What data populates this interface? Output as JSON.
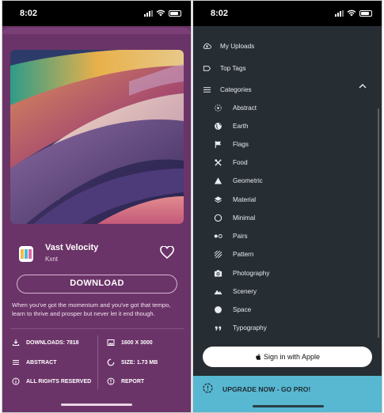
{
  "status_bar": {
    "time": "8:02"
  },
  "wallpaper": {
    "title": "Vast Velocity",
    "author": "Kxnt",
    "download_label": "DOWNLOAD",
    "description": "When you've got the momentum and you've got that tempo, learn to thrive and prosper but never let it end though.",
    "stats": {
      "downloads": "DOWNLOADS: 7818",
      "resolution": "1600 X 3000",
      "category": "ABSTRACT",
      "size": "SIZE: 1.73 MB",
      "rights": "ALL RIGHTS RESERVED",
      "report": "REPORT"
    },
    "icons": {
      "favorite": "heart-outline-icon",
      "downloads": "download-icon",
      "resolution": "image-icon",
      "category": "menu-lines-icon",
      "size": "size-circle-icon",
      "rights": "info-icon",
      "report": "report-icon"
    }
  },
  "drawer": {
    "top_items": [
      {
        "label": "My Uploads",
        "icon": "cloud-upload-icon"
      },
      {
        "label": "Top Tags",
        "icon": "tag-icon"
      },
      {
        "label": "Categories",
        "icon": "menu-icon"
      }
    ],
    "categories": [
      {
        "label": "Abstract",
        "icon": "abstract-dots-icon"
      },
      {
        "label": "Earth",
        "icon": "globe-icon"
      },
      {
        "label": "Flags",
        "icon": "flag-icon"
      },
      {
        "label": "Food",
        "icon": "utensils-icon"
      },
      {
        "label": "Geometric",
        "icon": "triangle-icon"
      },
      {
        "label": "Material",
        "icon": "layers-icon"
      },
      {
        "label": "Minimal",
        "icon": "circle-outline-icon"
      },
      {
        "label": "Pairs",
        "icon": "pairs-dots-icon"
      },
      {
        "label": "Pattern",
        "icon": "pattern-lines-icon"
      },
      {
        "label": "Photography",
        "icon": "camera-icon"
      },
      {
        "label": "Scenery",
        "icon": "mountain-icon"
      },
      {
        "label": "Space",
        "icon": "filled-circle-icon"
      },
      {
        "label": "Typography",
        "icon": "quote-icon"
      }
    ],
    "sign_in_label": "Sign in with Apple",
    "upgrade_label": "UPGRADE NOW - GO PRO!"
  },
  "colors": {
    "left_background": "#6b3468",
    "drawer_background": "#262d33",
    "upgrade_banner": "#58b7d1"
  }
}
